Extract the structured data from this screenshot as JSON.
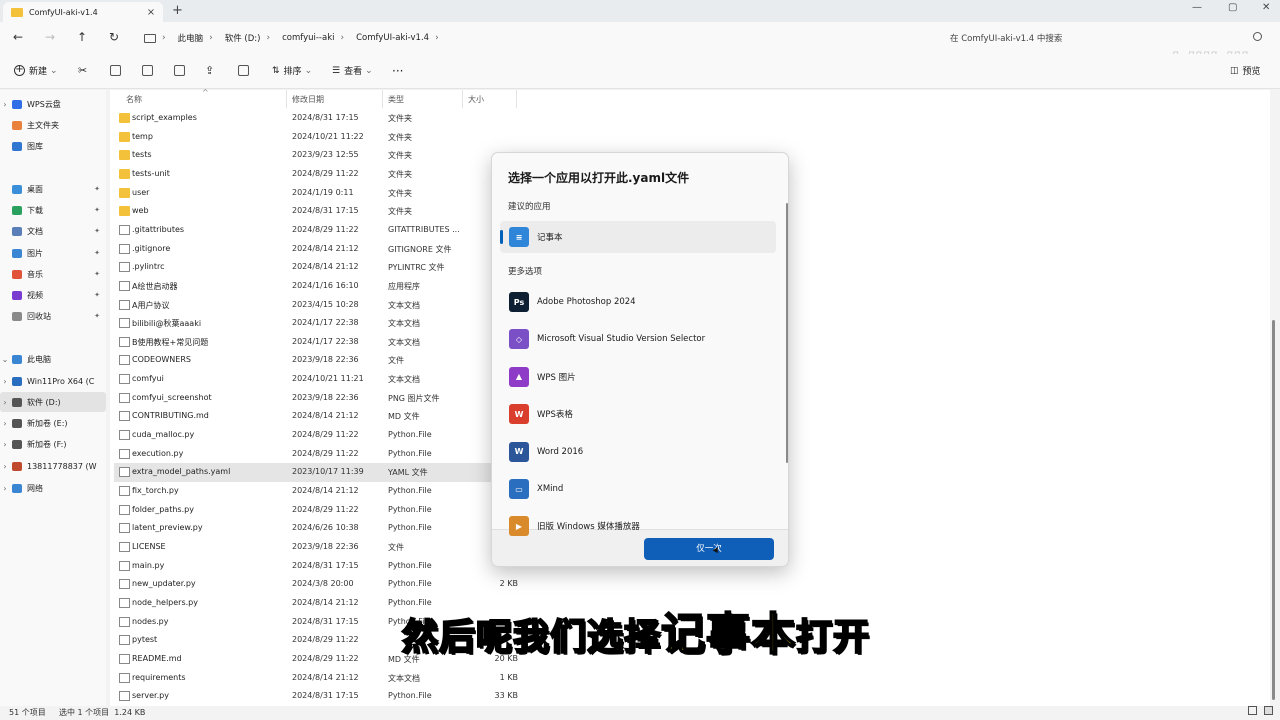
{
  "tab": {
    "title": "ComfyUI-aki-v1.4",
    "close": "×",
    "new": "+"
  },
  "window_controls": {
    "min": "—",
    "max": "▢",
    "close": "✕"
  },
  "breadcrumbs": [
    "此电脑",
    "软件 (D:)",
    "comfyui--aki",
    "ComfyUI-aki-v1.4"
  ],
  "search": {
    "placeholder": "在 ComfyUI-aki-v1.4 中搜索"
  },
  "watermark": "bilibili",
  "toolbar": {
    "new": "新建",
    "sort": "排序",
    "view": "查看",
    "more": "···",
    "preview": "预览"
  },
  "nav": [
    {
      "label": "WPS云盘",
      "icon": "wps-cloud-icon",
      "color": "#2f6ee6",
      "chevron": "›",
      "pinned": false
    },
    {
      "label": "主文件夹",
      "icon": "home-icon",
      "color": "#e9813c",
      "chevron": "",
      "pinned": false
    },
    {
      "label": "图库",
      "icon": "gallery-icon",
      "color": "#2f77d0",
      "chevron": "",
      "pinned": false
    },
    {
      "label": "桌面",
      "icon": "desktop-icon",
      "color": "#3b8fd8",
      "chevron": "",
      "pinned": true
    },
    {
      "label": "下载",
      "icon": "download-icon",
      "color": "#2aa15e",
      "chevron": "",
      "pinned": true
    },
    {
      "label": "文档",
      "icon": "documents-icon",
      "color": "#5a7fb8",
      "chevron": "",
      "pinned": true
    },
    {
      "label": "图片",
      "icon": "pictures-icon",
      "color": "#3a86d2",
      "chevron": "",
      "pinned": true
    },
    {
      "label": "音乐",
      "icon": "music-icon",
      "color": "#e0533a",
      "chevron": "",
      "pinned": true
    },
    {
      "label": "视频",
      "icon": "videos-icon",
      "color": "#7a3bd0",
      "chevron": "",
      "pinned": true
    },
    {
      "label": "回收站",
      "icon": "recycle-bin-icon",
      "color": "#8a8a8a",
      "chevron": "",
      "pinned": true
    },
    {
      "label": "此电脑",
      "icon": "this-pc-icon",
      "color": "#3a86d2",
      "chevron": "⌄",
      "pinned": false
    },
    {
      "label": "Win11Pro X64 (C",
      "icon": "drive-c-icon",
      "color": "#2a6fbf",
      "chevron": "›",
      "pinned": false
    },
    {
      "label": "软件 (D:)",
      "icon": "drive-d-icon",
      "color": "#555555",
      "chevron": "›",
      "pinned": false
    },
    {
      "label": "新加卷 (E:)",
      "icon": "drive-e-icon",
      "color": "#555555",
      "chevron": "›",
      "pinned": false
    },
    {
      "label": "新加卷 (F:)",
      "icon": "drive-f-icon",
      "color": "#555555",
      "chevron": "›",
      "pinned": false
    },
    {
      "label": "13811778837 (W",
      "icon": "network-drive-icon",
      "color": "#c04a2f",
      "chevron": "›",
      "pinned": false
    },
    {
      "label": "网络",
      "icon": "network-icon",
      "color": "#3a86d2",
      "chevron": "›",
      "pinned": false
    }
  ],
  "columns": {
    "name": "名称",
    "date": "修改日期",
    "type": "类型",
    "size": "大小"
  },
  "files": [
    {
      "name": "script_examples",
      "date": "2024/8/31 17:15",
      "type": "文件夹",
      "size": "",
      "kind": "folder"
    },
    {
      "name": "temp",
      "date": "2024/10/21 11:22",
      "type": "文件夹",
      "size": "",
      "kind": "folder"
    },
    {
      "name": "tests",
      "date": "2023/9/23 12:55",
      "type": "文件夹",
      "size": "",
      "kind": "folder"
    },
    {
      "name": "tests-unit",
      "date": "2024/8/29 11:22",
      "type": "文件夹",
      "size": "",
      "kind": "folder"
    },
    {
      "name": "user",
      "date": "2024/1/19 0:11",
      "type": "文件夹",
      "size": "",
      "kind": "folder"
    },
    {
      "name": "web",
      "date": "2024/8/31 17:15",
      "type": "文件夹",
      "size": "",
      "kind": "folder"
    },
    {
      "name": ".gitattributes",
      "date": "2024/8/29 11:22",
      "type": "GITATTRIBUTES ...",
      "size": "",
      "kind": "file"
    },
    {
      "name": ".gitignore",
      "date": "2024/8/14 21:12",
      "type": "GITIGNORE 文件",
      "size": "",
      "kind": "file"
    },
    {
      "name": ".pylintrc",
      "date": "2024/8/14 21:12",
      "type": "PYLINTRC 文件",
      "size": "",
      "kind": "file"
    },
    {
      "name": "A绘世启动器",
      "date": "2024/1/16 16:10",
      "type": "应用程序",
      "size": "2,0",
      "kind": "file"
    },
    {
      "name": "A用户协议",
      "date": "2023/4/15 10:28",
      "type": "文本文档",
      "size": "",
      "kind": "file"
    },
    {
      "name": "bilibili@秋葉aaaki",
      "date": "2024/1/17 22:38",
      "type": "文本文档",
      "size": "",
      "kind": "file"
    },
    {
      "name": "B使用教程+常见问题",
      "date": "2024/1/17 22:38",
      "type": "文本文档",
      "size": "",
      "kind": "file"
    },
    {
      "name": "CODEOWNERS",
      "date": "2023/9/18 22:36",
      "type": "文件",
      "size": "",
      "kind": "file"
    },
    {
      "name": "comfyui",
      "date": "2024/10/21 11:21",
      "type": "文本文档",
      "size": "",
      "kind": "file"
    },
    {
      "name": "comfyui_screenshot",
      "date": "2023/9/18 22:36",
      "type": "PNG 图片文件",
      "size": "1",
      "kind": "file"
    },
    {
      "name": "CONTRIBUTING.md",
      "date": "2024/8/14 21:12",
      "type": "MD 文件",
      "size": "",
      "kind": "file"
    },
    {
      "name": "cuda_malloc.py",
      "date": "2024/8/29 11:22",
      "type": "Python.File",
      "size": "",
      "kind": "file"
    },
    {
      "name": "execution.py",
      "date": "2024/8/29 11:22",
      "type": "Python.File",
      "size": "4",
      "kind": "file"
    },
    {
      "name": "extra_model_paths.yaml",
      "date": "2023/10/17 11:39",
      "type": "YAML 文件",
      "size": "",
      "kind": "file",
      "selected": true
    },
    {
      "name": "fix_torch.py",
      "date": "2024/8/14 21:12",
      "type": "Python.File",
      "size": "",
      "kind": "file"
    },
    {
      "name": "folder_paths.py",
      "date": "2024/8/29 11:22",
      "type": "Python.File",
      "size": "",
      "kind": "file"
    },
    {
      "name": "latent_preview.py",
      "date": "2024/6/26 10:38",
      "type": "Python.File",
      "size": "",
      "kind": "file"
    },
    {
      "name": "LICENSE",
      "date": "2023/9/18 22:36",
      "type": "文件",
      "size": "",
      "kind": "file"
    },
    {
      "name": "main.py",
      "date": "2024/8/31 17:15",
      "type": "Python.File",
      "size": "",
      "kind": "file"
    },
    {
      "name": "new_updater.py",
      "date": "2024/3/8 20:00",
      "type": "Python.File",
      "size": "2 KB",
      "kind": "file"
    },
    {
      "name": "node_helpers.py",
      "date": "2024/8/14 21:12",
      "type": "Python.File",
      "size": "",
      "kind": "file"
    },
    {
      "name": "nodes.py",
      "date": "2024/8/31 17:15",
      "type": "Python.File",
      "size": "",
      "kind": "file"
    },
    {
      "name": "pytest",
      "date": "2024/8/29 11:22",
      "type": "",
      "size": "",
      "kind": "file"
    },
    {
      "name": "README.md",
      "date": "2024/8/29 11:22",
      "type": "MD 文件",
      "size": "20 KB",
      "kind": "file"
    },
    {
      "name": "requirements",
      "date": "2024/8/14 21:12",
      "type": "文本文档",
      "size": "1 KB",
      "kind": "file"
    },
    {
      "name": "server.py",
      "date": "2024/8/31 17:15",
      "type": "Python.File",
      "size": "33 KB",
      "kind": "file"
    }
  ],
  "status": {
    "count": "51 个项目",
    "selection": "选中 1 个项目  1.24 KB"
  },
  "dialog": {
    "title": "选择一个应用以打开此.yaml文件",
    "suggested_label": "建议的应用",
    "more_label": "更多选项",
    "suggested": [
      {
        "name": "记事本",
        "icon": "notepad-icon",
        "color": "#2f86d8",
        "glyph": "≡"
      }
    ],
    "apps": [
      {
        "name": "Adobe Photoshop 2024",
        "icon": "photoshop-icon",
        "color": "#0c1f33",
        "glyph": "Ps"
      },
      {
        "name": "Microsoft Visual Studio Version Selector",
        "icon": "visual-studio-icon",
        "color": "#7b4fc6",
        "glyph": "◇"
      },
      {
        "name": "WPS 图片",
        "icon": "wps-picture-icon",
        "color": "#8e3cc8",
        "glyph": "▲"
      },
      {
        "name": "WPS表格",
        "icon": "wps-spreadsheet-icon",
        "color": "#d93f2c",
        "glyph": "W"
      },
      {
        "name": "Word 2016",
        "icon": "word-icon",
        "color": "#2b579a",
        "glyph": "W"
      },
      {
        "name": "XMind",
        "icon": "xmind-icon",
        "color": "#2a6fbf",
        "glyph": "▭"
      },
      {
        "name": "旧版 Windows 媒体播放器",
        "icon": "media-player-icon",
        "color": "#d98a2a",
        "glyph": "▶"
      }
    ],
    "once_button": "仅一次"
  },
  "caption": {
    "before": "然后呢我们选择",
    "highlight": "记事本",
    "after": "打开"
  }
}
